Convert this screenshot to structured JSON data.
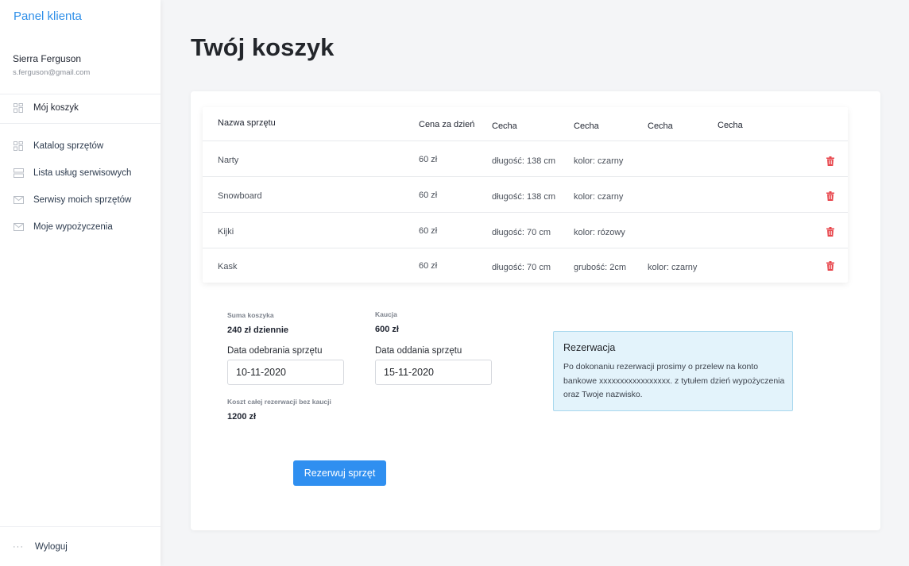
{
  "sidebar": {
    "brand": "Panel klienta",
    "user": {
      "name": "Sierra Ferguson",
      "email": "s.ferguson@gmail.com"
    },
    "items": [
      {
        "label": "Mój koszyk",
        "icon": "grid-icon",
        "active": true
      },
      {
        "label": "Katalog sprzętów",
        "icon": "grid-icon"
      },
      {
        "label": "Lista usług serwisowych",
        "icon": "list-icon"
      },
      {
        "label": "Serwisy moich sprzętów",
        "icon": "mail-icon"
      },
      {
        "label": "Moje wypożyczenia",
        "icon": "mail-icon"
      }
    ],
    "logout": {
      "label": "Wyloguj",
      "icon": "dots-icon"
    }
  },
  "page": {
    "title": "Twój koszyk"
  },
  "table": {
    "headers": [
      "Nazwa sprzętu",
      "Cena za dzień",
      "Cecha",
      "Cecha",
      "Cecha",
      "Cecha"
    ],
    "rows": [
      {
        "name": "Narty",
        "price": "60 zł",
        "f1": "długość: 138 cm",
        "f2": "kolor: czarny",
        "f3": ""
      },
      {
        "name": "Snowboard",
        "price": "60 zł",
        "f1": "długość: 138 cm",
        "f2": "kolor: czarny",
        "f3": ""
      },
      {
        "name": "Kijki",
        "price": "60 zł",
        "f1": "długość: 70 cm",
        "f2": "kolor: rózowy",
        "f3": ""
      },
      {
        "name": "Kask",
        "price": "60 zł",
        "f1": "długość: 70 cm",
        "f2": "grubość: 2cm",
        "f3": "kolor: czarny"
      }
    ],
    "delete_icon": "trash-icon",
    "delete_color": "#e8474d"
  },
  "summary": {
    "sum_label": "Suma koszyka",
    "sum_value": "240 zł dziennie",
    "deposit_label": "Kaucja",
    "deposit_value": "600 zł",
    "pickup_label": "Data odebrania sprzętu",
    "pickup_value": "10-11-2020",
    "return_label": "Data oddania sprzętu",
    "return_value": "15-11-2020",
    "total_label": "Koszt całej rezerwacji bez kaucji",
    "total_value": "1200 zł"
  },
  "info": {
    "title": "Rezerwacja",
    "text": "Po dokonaniu rezerwacji prosimy o przelew na konto bankowe xxxxxxxxxxxxxxxxx. z tytułem dzień wypożyczenia oraz Twoje nazwisko."
  },
  "actions": {
    "reserve_label": "Rezerwuj sprzęt"
  },
  "colors": {
    "accent": "#2f8ff0",
    "brand": "#2f8fe8",
    "info_bg": "#e3f3fb",
    "info_border": "#a9d8ee"
  }
}
